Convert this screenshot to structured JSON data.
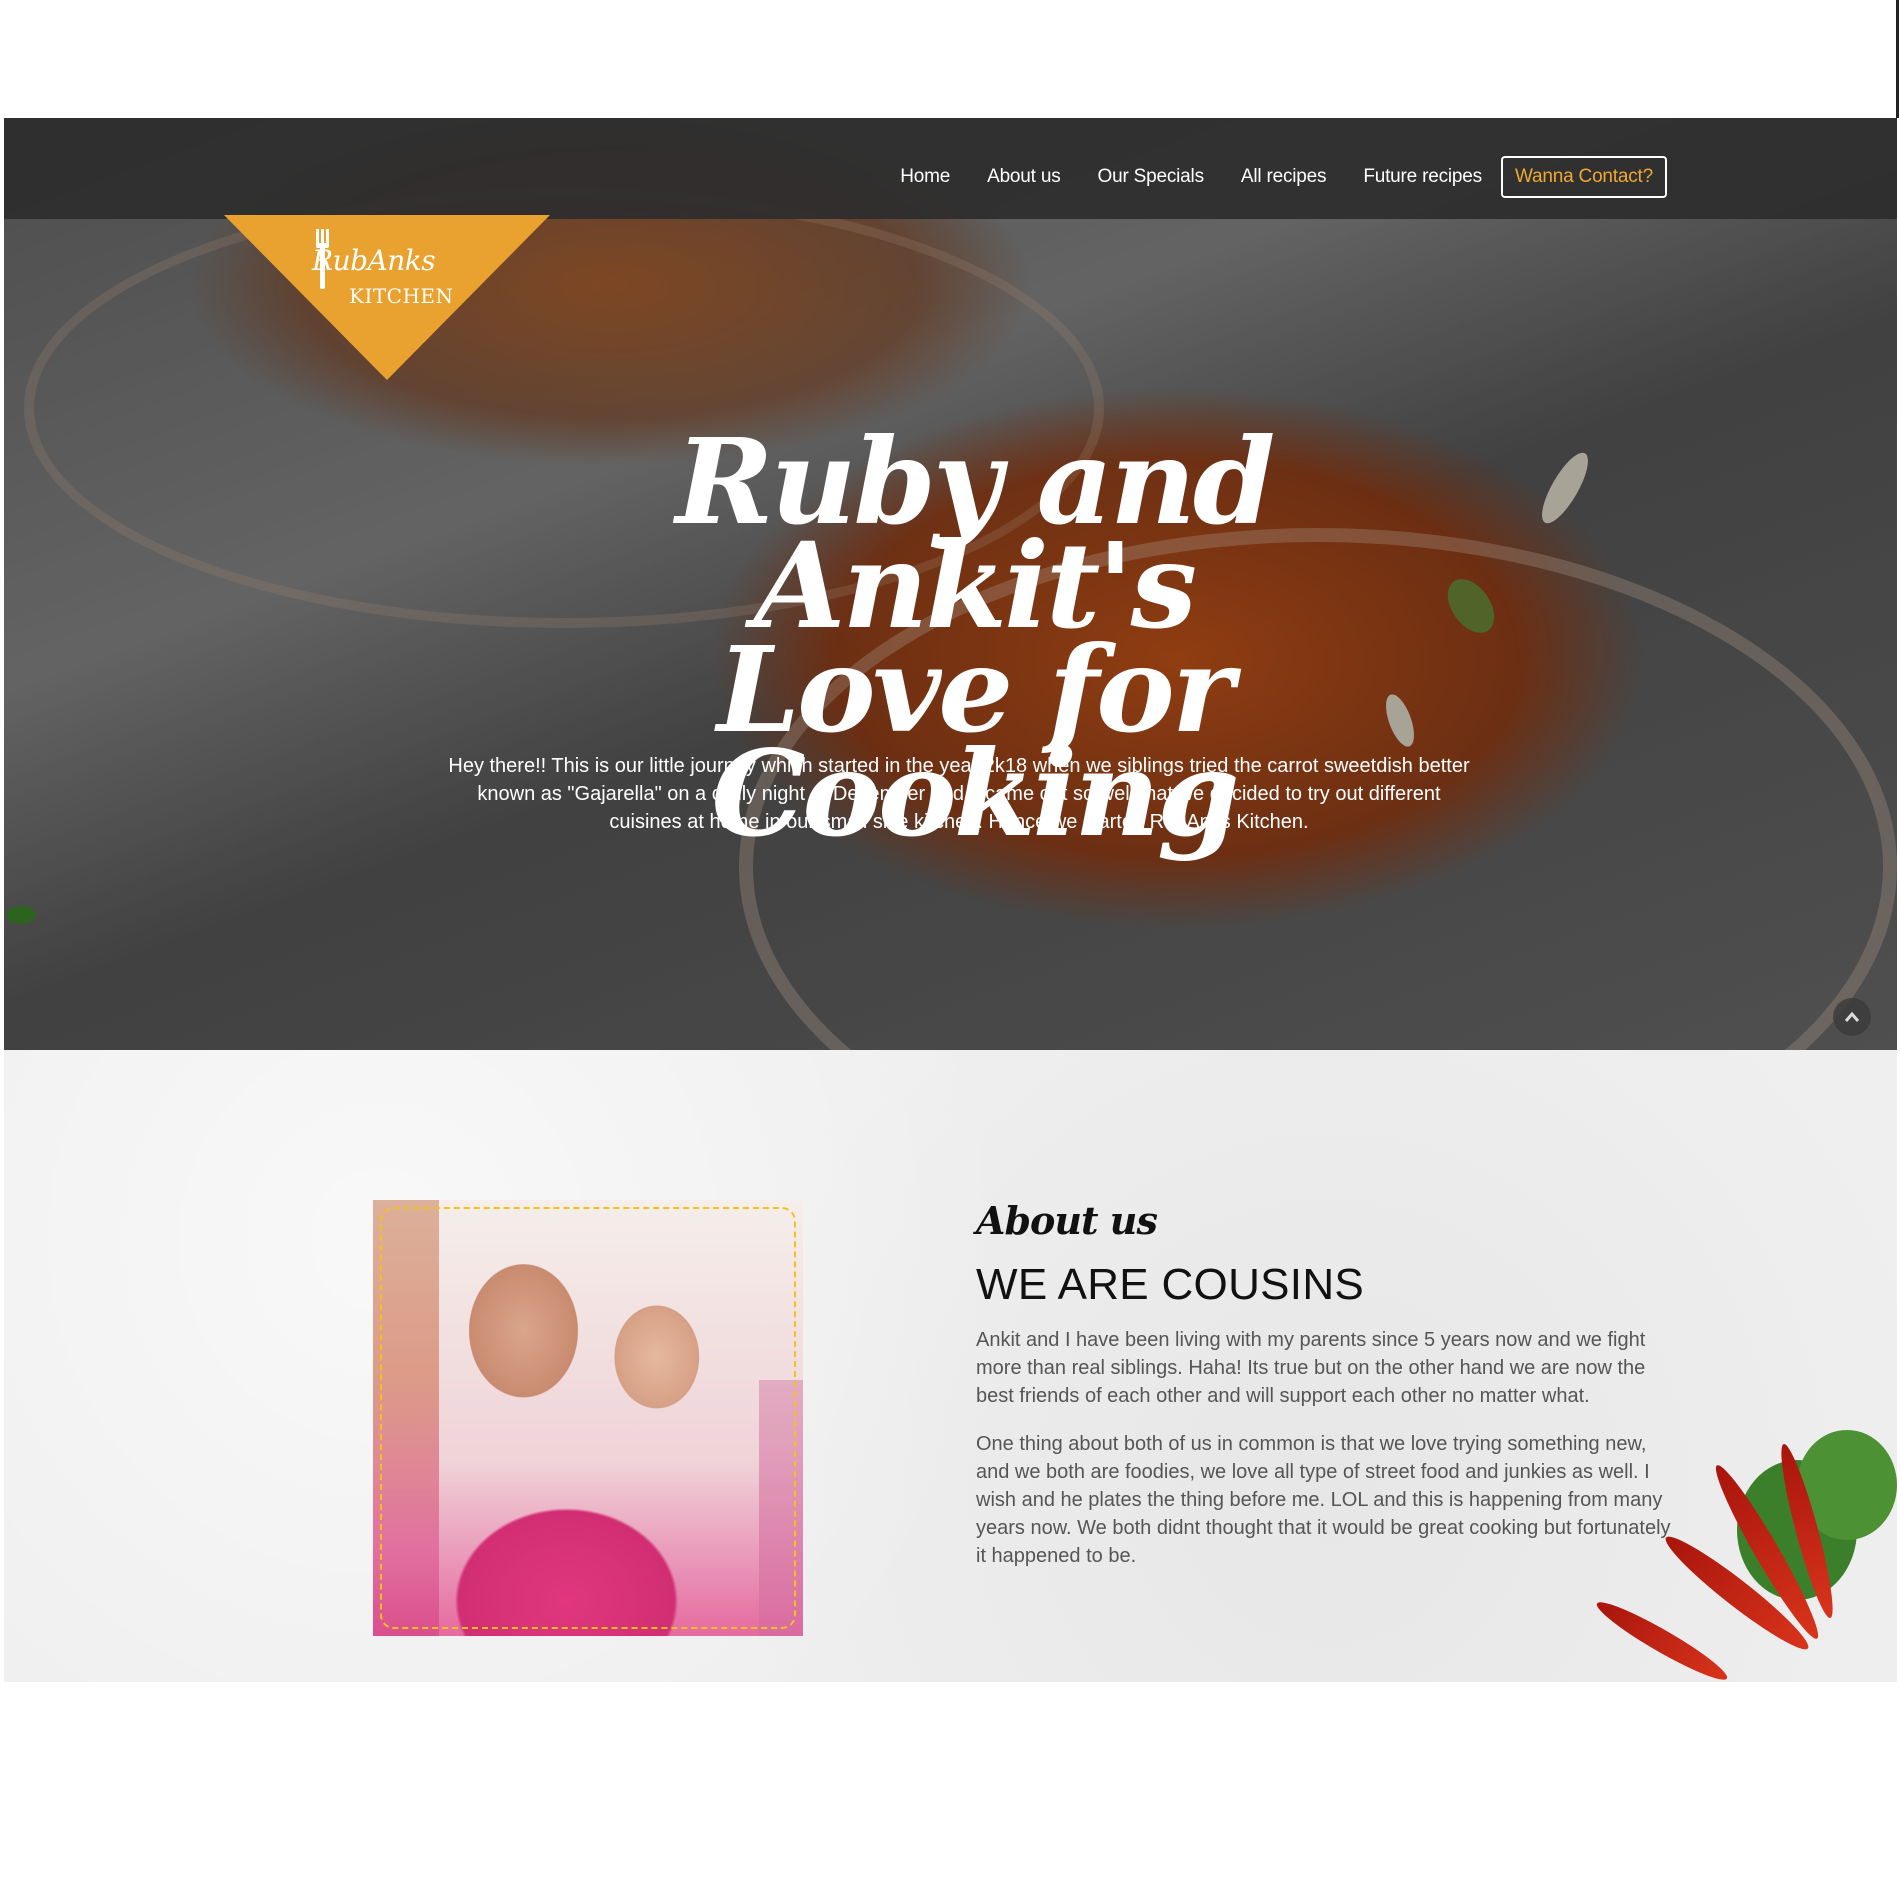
{
  "nav": {
    "items": [
      "Home",
      "About us",
      "Our Specials",
      "All recipes",
      "Future recipes"
    ],
    "contact_label": "Wanna Contact?"
  },
  "logo": {
    "line1": "RubAnks",
    "line2": "KITCHEN"
  },
  "hero": {
    "title_line1": "Ruby and Ankit's",
    "title_line2": "Love for Cooking",
    "text": "Hey there!! This is our little journey which started in the year 2k18 when we siblings tried the carrot sweetdish better known as \"Gajarella\" on a chilly night of December and it came out so well that we decided to try out different cuisines at home in our small size kitchen. Hence we started RubAnks Kitchen."
  },
  "scroll_top_icon": "chevron-up-icon",
  "about": {
    "script_title": "About us",
    "heading": "WE ARE COUSINS",
    "paragraph1": "Ankit and I have been living with my parents since 5 years now and we fight more than real siblings. Haha! Its true but on the other hand we are now the best friends of each other and will support each other no matter what.",
    "paragraph2": "One thing about both of us in common is that we love trying something new, and we both are foodies, we love all type of street food and junkies as well. I wish and he plates the thing before me. LOL and this is happening from many years now. We both didnt thought that it would be great cooking but fortunately it happened to be."
  },
  "colors": {
    "accent": "#f0a830",
    "logo_bg": "#e9a12f",
    "navbar_bg": "#2d2d2d",
    "photo_frame": "#f2c21b"
  }
}
